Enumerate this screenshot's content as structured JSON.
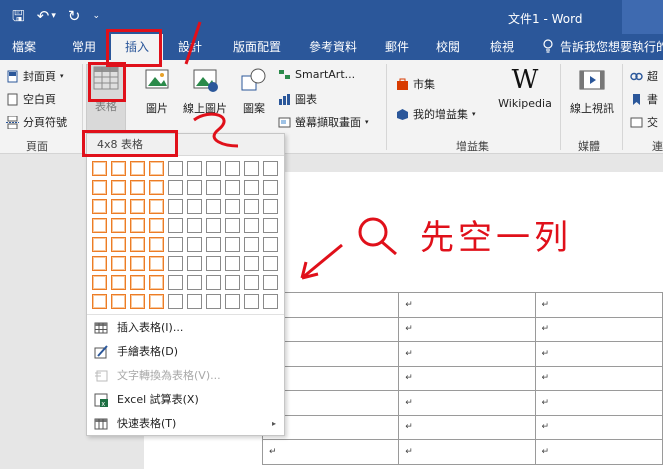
{
  "titlebar": {
    "title": "文件1 - Word",
    "qat_save": "🖫",
    "qat_undo": "↶",
    "qat_undo_more": "▾",
    "qat_redo": "↻",
    "qat_custom": "⌄"
  },
  "tabs": [
    {
      "label": "檔案"
    },
    {
      "label": "常用"
    },
    {
      "label": "插入"
    },
    {
      "label": "設計"
    },
    {
      "label": "版面配置"
    },
    {
      "label": "參考資料"
    },
    {
      "label": "郵件"
    },
    {
      "label": "校閱"
    },
    {
      "label": "檢視"
    }
  ],
  "tell_me": "告訴我您想要執行的動作",
  "ribbon": {
    "pages": {
      "cover": "封面頁",
      "blank": "空白頁",
      "break": "分頁符號",
      "group": "頁面"
    },
    "table": {
      "label": "表格"
    },
    "illustrations": {
      "pictures": "圖片",
      "online_pictures": "線上圖片",
      "shapes": "圖案",
      "smartart": "SmartArt...",
      "chart": "圖表",
      "screenshot": "螢幕擷取畫面"
    },
    "addins": {
      "store": "市集",
      "my_addins": "我的增益集",
      "wikipedia": "Wikipedia",
      "wiki_glyph": "W",
      "group": "增益集"
    },
    "media": {
      "online_video": "線上視訊",
      "group": "媒體"
    },
    "links": {
      "hyperlink": "超",
      "bookmark": "書",
      "crossref": "交"
    },
    "links_group": "連"
  },
  "dropdown": {
    "header": "4x8 表格",
    "items": [
      {
        "label": "插入表格(I)..."
      },
      {
        "label": "手繪表格(D)"
      },
      {
        "label": "文字轉換為表格(V)..."
      },
      {
        "label": "Excel 試算表(X)"
      },
      {
        "label": "快速表格(T)"
      }
    ],
    "submenu_arrow": "▸",
    "grid_cols": 10,
    "grid_rows": 8,
    "selected_cols": 4,
    "selected_rows": 8
  },
  "document": {
    "paragraph_mark": "↵",
    "rows": 7,
    "cols": 3
  },
  "annotation": {
    "text": "先空一列",
    "color": "#e0101a"
  },
  "colors": {
    "ribbon_blue": "#2b579a",
    "selection_orange": "#ec7c26"
  }
}
